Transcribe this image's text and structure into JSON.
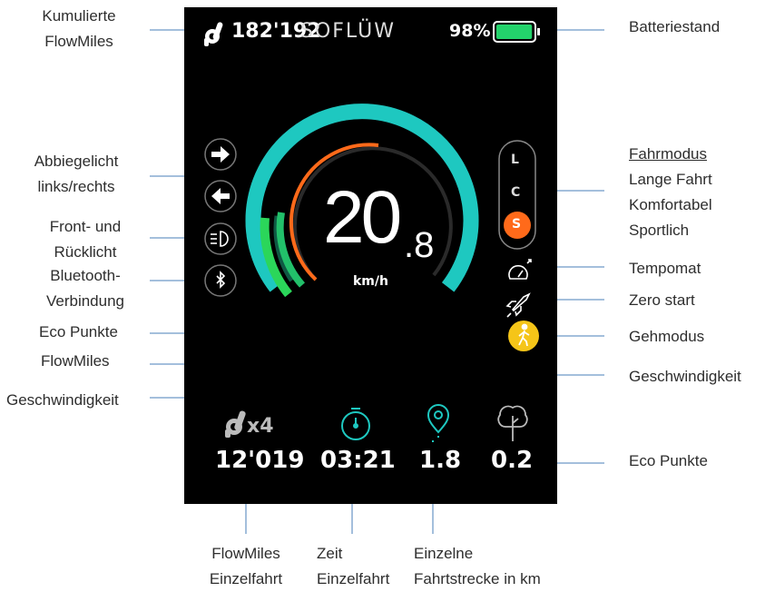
{
  "display": {
    "flowmiles_total": "182'192",
    "brand": "SOFLÜW",
    "battery_percent": "98%",
    "battery_level": 0.98,
    "speed_int": "20",
    "speed_dec": ".8",
    "speed_unit": "km/h",
    "modes": [
      "L",
      "C",
      "S"
    ],
    "active_mode": "S",
    "multiplier": "x4",
    "stats": [
      {
        "icon": "flowmiles-icon",
        "value": "12'019"
      },
      {
        "icon": "stopwatch-icon",
        "value": "03:21"
      },
      {
        "icon": "location-pin-icon",
        "value": "1.8"
      },
      {
        "icon": "tree-icon",
        "value": "0.2"
      }
    ],
    "colors": {
      "teal": "#1ec8c0",
      "orange": "#ff6a1a",
      "green": "#2bd65a",
      "yellow": "#f5c518",
      "battery": "#23d36b"
    }
  },
  "labels": {
    "kumulierte": [
      "Kumulierte",
      "FlowMiles"
    ],
    "batterie": "Batteriestand",
    "abbiegelicht": [
      "Abbiegelicht",
      "links/rechts"
    ],
    "frontlicht": [
      "Front- und",
      "Rücklicht"
    ],
    "bluetooth": [
      "Bluetooth-",
      "Verbindung"
    ],
    "eco_left": "Eco Punkte",
    "flowmiles_left": "FlowMiles",
    "speed_left": "Geschwindigkeit",
    "fahrmodus_title": "Fahrmodus",
    "fahrmodus_items": [
      "Lange Fahrt",
      "Komfortabel",
      "Sportlich"
    ],
    "tempomat": "Tempomat",
    "zero_start": "Zero start",
    "gehmodus": "Gehmodus",
    "speed_right": "Geschwindigkeit",
    "eco_right": "Eco Punkte",
    "flowmiles_single": [
      "FlowMiles",
      "Einzelfahrt"
    ],
    "zeit": [
      "Zeit",
      "Einzelfahrt"
    ],
    "strecke": [
      "Einzelne",
      "Fahrtstrecke in km"
    ]
  }
}
